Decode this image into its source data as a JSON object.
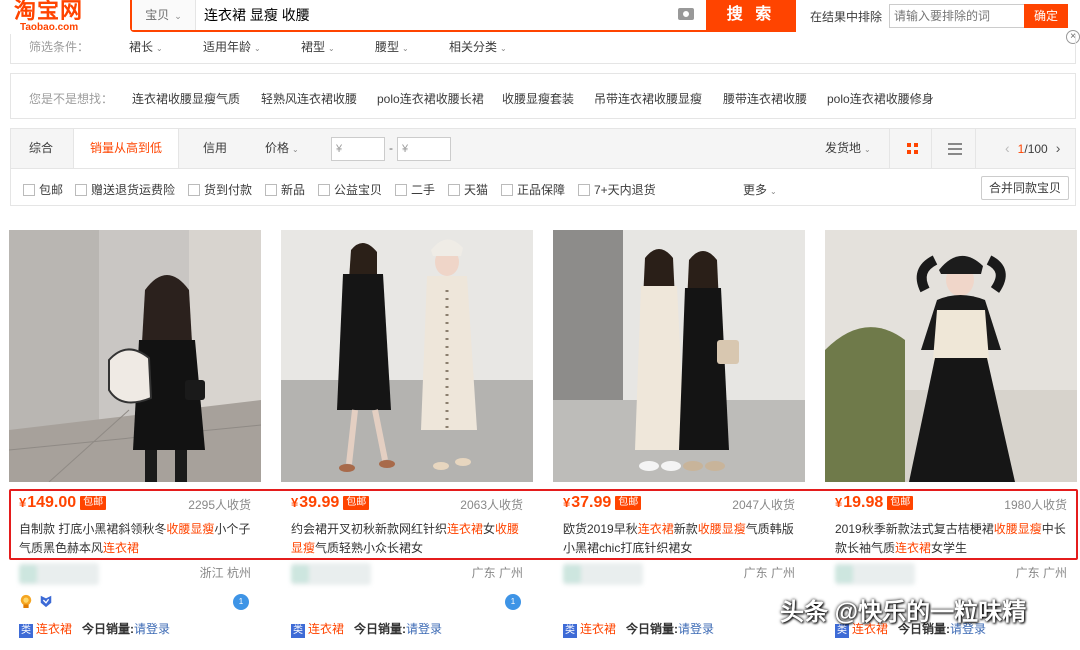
{
  "logo": {
    "cn": "淘宝网",
    "en": "Taobao.com"
  },
  "search": {
    "category": "宝贝",
    "query": "连衣裙 显瘦 收腰",
    "button": "搜 索"
  },
  "exclude": {
    "label": "在结果中排除",
    "placeholder": "请输入要排除的词",
    "button": "确定"
  },
  "close": "×",
  "filters": {
    "label": "筛选条件：",
    "items": [
      "裙长",
      "适用年龄",
      "裙型",
      "腰型",
      "相关分类"
    ]
  },
  "guess": {
    "label": "您是不是想找：",
    "items": [
      "连衣裙收腰显瘦气质",
      "轻熟风连衣裙收腰",
      "polo连衣裙收腰长裙",
      "收腰显瘦套装",
      "吊带连衣裙收腰显瘦",
      "腰带连衣裙收腰",
      "polo连衣裙收腰修身"
    ]
  },
  "sort": {
    "items": [
      "综合",
      "销量从高到低",
      "信用",
      "价格"
    ],
    "active": "销量从高到低",
    "price_from_placeholder": "¥",
    "price_to_placeholder": "¥",
    "dash": "-",
    "ship_from": "发货地",
    "pager": {
      "current": "1",
      "total": "/100"
    }
  },
  "checks": {
    "items": [
      "包邮",
      "赠送退货运费险",
      "货到付款",
      "新品",
      "公益宝贝",
      "二手",
      "天猫",
      "正品保障",
      "7+天内退货"
    ],
    "more": "更多",
    "merge": "合并同款宝贝"
  },
  "products": [
    {
      "currency": "¥",
      "price": "149.00",
      "tag": "包邮",
      "sales": "2295人收货",
      "title_parts": [
        "自制款 打底小黑裙斜领秋冬",
        "收腰显瘦",
        "小个子气质黑色赫本风",
        "连衣裙",
        ""
      ],
      "location": "浙江 杭州",
      "category": "连衣裙",
      "today": "今日销量:",
      "login": "请登录"
    },
    {
      "currency": "¥",
      "price": "39.99",
      "tag": "包邮",
      "sales": "2063人收货",
      "title_parts": [
        "约会裙开叉初秋新款网红针织",
        "连衣裙",
        "女",
        "收腰显瘦",
        "气质轻熟小众长裙女"
      ],
      "location": "广东 广州",
      "category": "连衣裙",
      "today": "今日销量:",
      "login": "请登录"
    },
    {
      "currency": "¥",
      "price": "37.99",
      "tag": "包邮",
      "sales": "2047人收货",
      "title_parts": [
        "欧货2019早秋",
        "连衣裙",
        "新款",
        "收腰显瘦",
        "气质韩版小黑裙chic打底针织裙女"
      ],
      "location": "广东 广州",
      "category": "连衣裙",
      "today": "今日销量:",
      "login": "请登录"
    },
    {
      "currency": "¥",
      "price": "19.98",
      "tag": "包邮",
      "sales": "1980人收货",
      "title_parts": [
        "2019秋季新款法式复古桔梗裙",
        "收腰显瘦",
        "中长款长袖气质",
        "连衣裙",
        "女学生"
      ],
      "location": "广东 广州",
      "category": "连衣裙",
      "today": "今日销量:",
      "login": "请登录"
    }
  ],
  "watermark": "头条 @快乐的一粒味精",
  "colors": {
    "accent": "#ff4400",
    "highlight_box": "#e41c1c"
  }
}
